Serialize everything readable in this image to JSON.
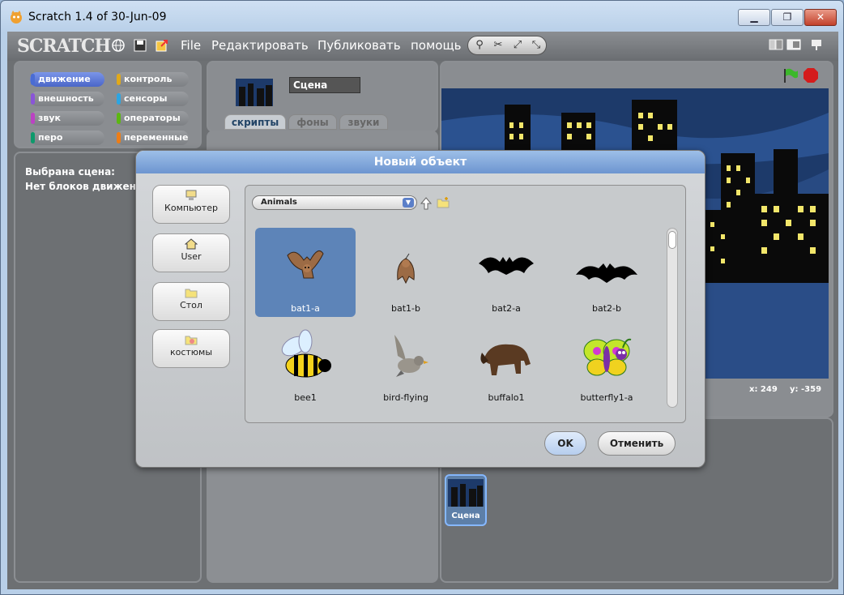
{
  "window": {
    "title": "Scratch 1.4 of 30-Jun-09",
    "min_label": "▁",
    "max_label": "❐",
    "close_label": "✕"
  },
  "menubar": {
    "logo": "SCRATCH",
    "menus": [
      "File",
      "Редактировать",
      "Публиковать",
      "помощь"
    ]
  },
  "categories": [
    {
      "label": "движение",
      "color": "#4a6cd4"
    },
    {
      "label": "контроль",
      "color": "#e1a91a"
    },
    {
      "label": "внешность",
      "color": "#8a55d7"
    },
    {
      "label": "сенсоры",
      "color": "#2ca5e2"
    },
    {
      "label": "звук",
      "color": "#bb42c3"
    },
    {
      "label": "операторы",
      "color": "#5cb712"
    },
    {
      "label": "перо",
      "color": "#0e9a6c"
    },
    {
      "label": "переменные",
      "color": "#ee7d16"
    }
  ],
  "blocks_text": [
    "Выбрана сцена:",
    "Нет блоков движения"
  ],
  "sprite": {
    "name": "Сцена"
  },
  "tabs": [
    "скрипты",
    "фоны",
    "звуки"
  ],
  "stage_coords": {
    "x": "x: 249",
    "y": "y: -359"
  },
  "sprite_corral": {
    "stage_label": "Сцена"
  },
  "dialog": {
    "title": "Новый объект",
    "side_buttons": [
      "Компьютер",
      "User",
      "Стол",
      "костюмы"
    ],
    "folder": "Animals",
    "items": [
      "bat1-a",
      "bat1-b",
      "bat2-a",
      "bat2-b",
      "bee1",
      "bird-flying",
      "buffalo1",
      "butterfly1-a"
    ],
    "ok": "OK",
    "cancel": "Отменить"
  }
}
